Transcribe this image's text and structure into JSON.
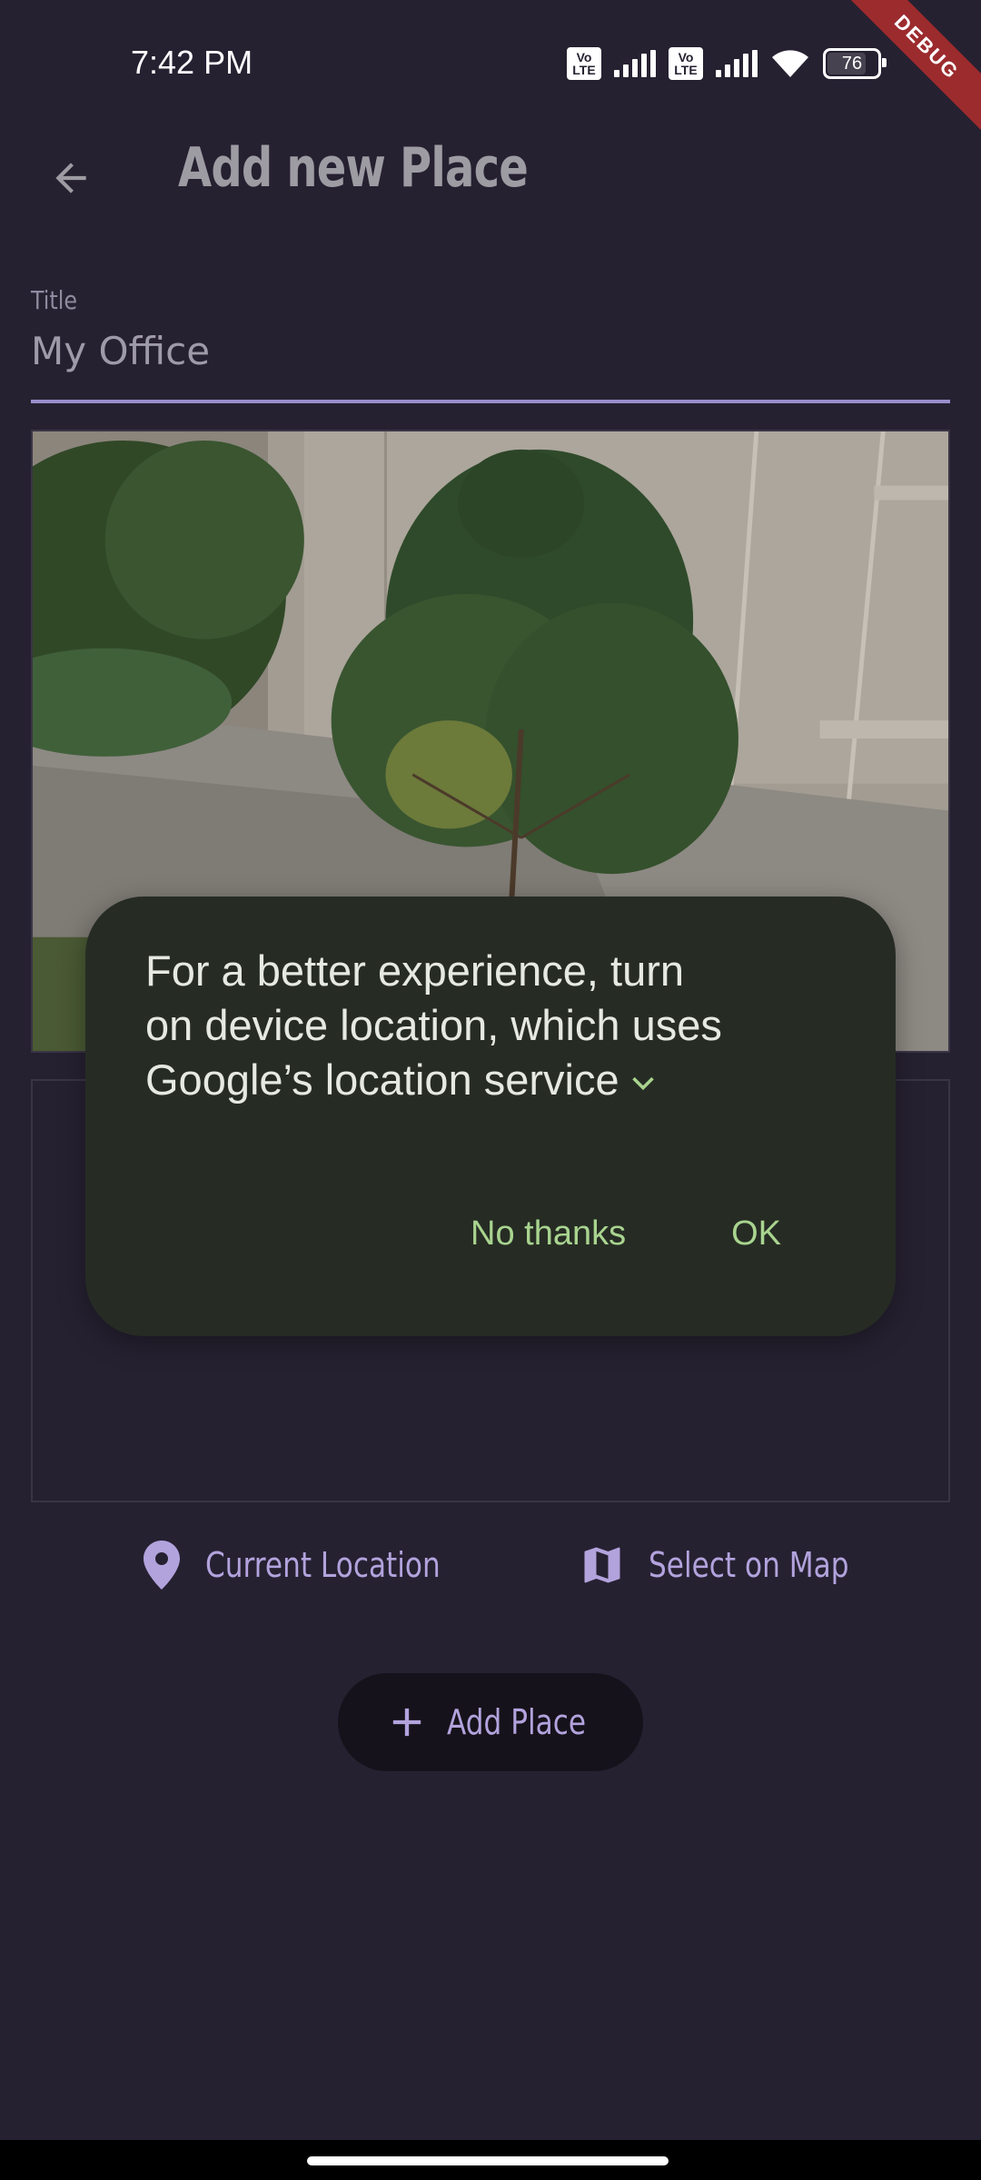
{
  "status_bar": {
    "time": "7:42 PM",
    "volte_1": "Vo LTE",
    "volte_2": "Vo LTE",
    "battery": "76"
  },
  "debug_banner": "DEBUG",
  "app_bar": {
    "title": "Add new Place",
    "back_icon": "arrow-back-icon"
  },
  "title_field": {
    "label": "Title",
    "value": "My Office"
  },
  "location_actions": {
    "current_label": "Current Location",
    "current_icon": "location-pin-icon",
    "map_label": "Select on Map",
    "map_icon": "map-icon"
  },
  "add_place": {
    "label": "Add Place",
    "icon": "plus-icon"
  },
  "dialog": {
    "line1": "For a better experience, turn",
    "line2": "on device location, which uses",
    "line3": "Google’s location service",
    "no_thanks": "No thanks",
    "ok": "OK"
  },
  "colors": {
    "background": "#262131",
    "accent": "#b2a3dd",
    "dialog_bg": "#262c24",
    "dialog_button": "#a9d48f",
    "debug_banner": "#9c2b2e"
  }
}
